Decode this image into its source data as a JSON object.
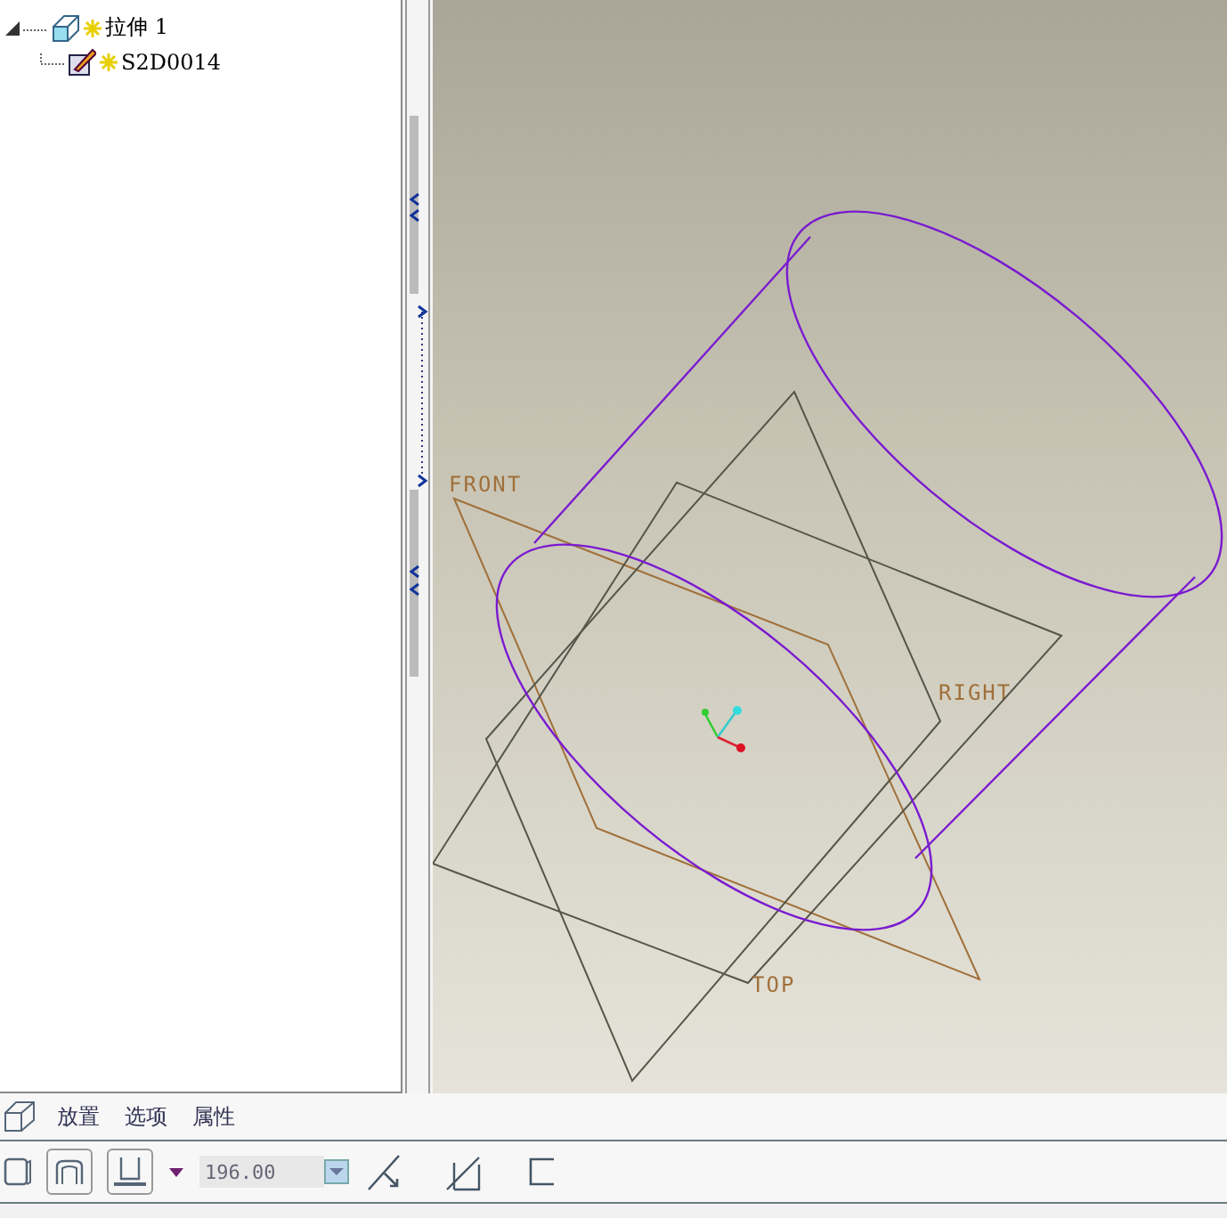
{
  "tree": {
    "items": [
      {
        "label": "拉伸 1",
        "expanded": true,
        "children": [
          {
            "label": "S2D0014"
          }
        ]
      }
    ]
  },
  "viewport": {
    "datum_planes": [
      {
        "label": "FRONT"
      },
      {
        "label": "RIGHT"
      },
      {
        "label": "TOP"
      }
    ]
  },
  "dashboard": {
    "tabs": [
      {
        "label": "放置",
        "selected": false
      },
      {
        "label": "选项",
        "selected": false
      },
      {
        "label": "属性",
        "selected": false
      }
    ],
    "depth": {
      "value": "196.00"
    }
  }
}
